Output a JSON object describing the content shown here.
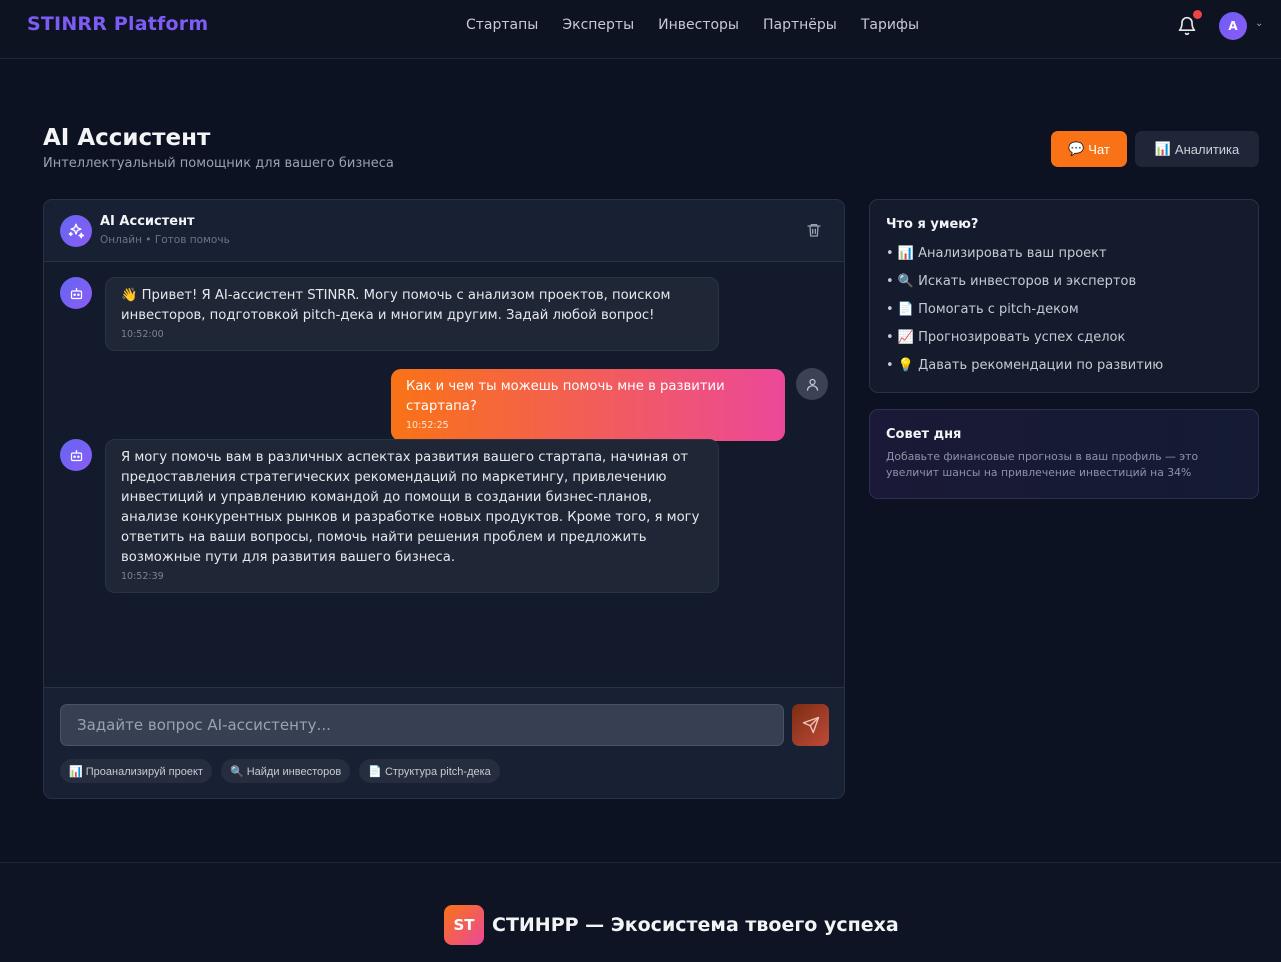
{
  "header": {
    "brand": "STINRR Platform",
    "nav": [
      "Стартапы",
      "Эксперты",
      "Инвесторы",
      "Партнёры",
      "Тарифы"
    ],
    "avatar_letter": "A"
  },
  "page": {
    "title": "AI Ассистент",
    "subtitle": "Интеллектуальный помощник для вашего бизнеса",
    "chat_button": "Чат",
    "analytics_button": "Аналитика"
  },
  "chat": {
    "assistant_name": "AI Ассистент",
    "status": "Онлайн • Готов помочь",
    "messages": [
      {
        "role": "assistant",
        "text": "👋 Привет! Я AI-ассистент STINRR. Могу помочь с анализом проектов, поиском инвесторов, подготовкой pitch-дека и многим другим. Задай любой вопрос!",
        "time": "10:52:00"
      },
      {
        "role": "user",
        "text": "Как и чем ты можешь помочь мне в развитии стартапа?",
        "time": "10:52:25"
      },
      {
        "role": "assistant",
        "text": "Я могу помочь вам в различных аспектах развития вашего стартапа, начиная от предоставления стратегических рекомендаций по маркетингу, привлечению инвестиций и управлению командой до помощи в создании бизнес-планов, анализе конкурентных рынков и разработке новых продуктов. Кроме того, я могу ответить на ваши вопросы, помочь найти решения проблем и предложить возможные пути для развития вашего бизнеса.",
        "time": "10:52:39"
      }
    ],
    "input_placeholder": "Задайте вопрос AI-ассистенту...",
    "quick_actions": [
      "📊 Проанализируй проект",
      "🔍 Найди инвесторов",
      "📄 Структура pitch-дека"
    ]
  },
  "skills": {
    "title": "Что я умею?",
    "items": [
      "• 📊 Анализировать ваш проект",
      "• 🔍 Искать инвесторов и экспертов",
      "• 📄 Помогать с pitch-деком",
      "• 📈 Прогнозировать успех сделок",
      "• 💡 Давать рекомендации по развитию"
    ]
  },
  "tip": {
    "title": "Совет дня",
    "text": "Добавьте финансовые прогнозы в ваш профиль — это увеличит шансы на привлечение инвестиций на 34%"
  },
  "footer": {
    "logo": "ST",
    "title": "СТИНРР — Экосистема твоего успеха"
  },
  "icons": {
    "chat_button": "💬",
    "analytics_button": "📊"
  },
  "colors": {
    "accent_orange": "#f97316",
    "accent_pink": "#ec4899",
    "brand_purple": "#7c5cf5",
    "background": "#0d1222"
  }
}
